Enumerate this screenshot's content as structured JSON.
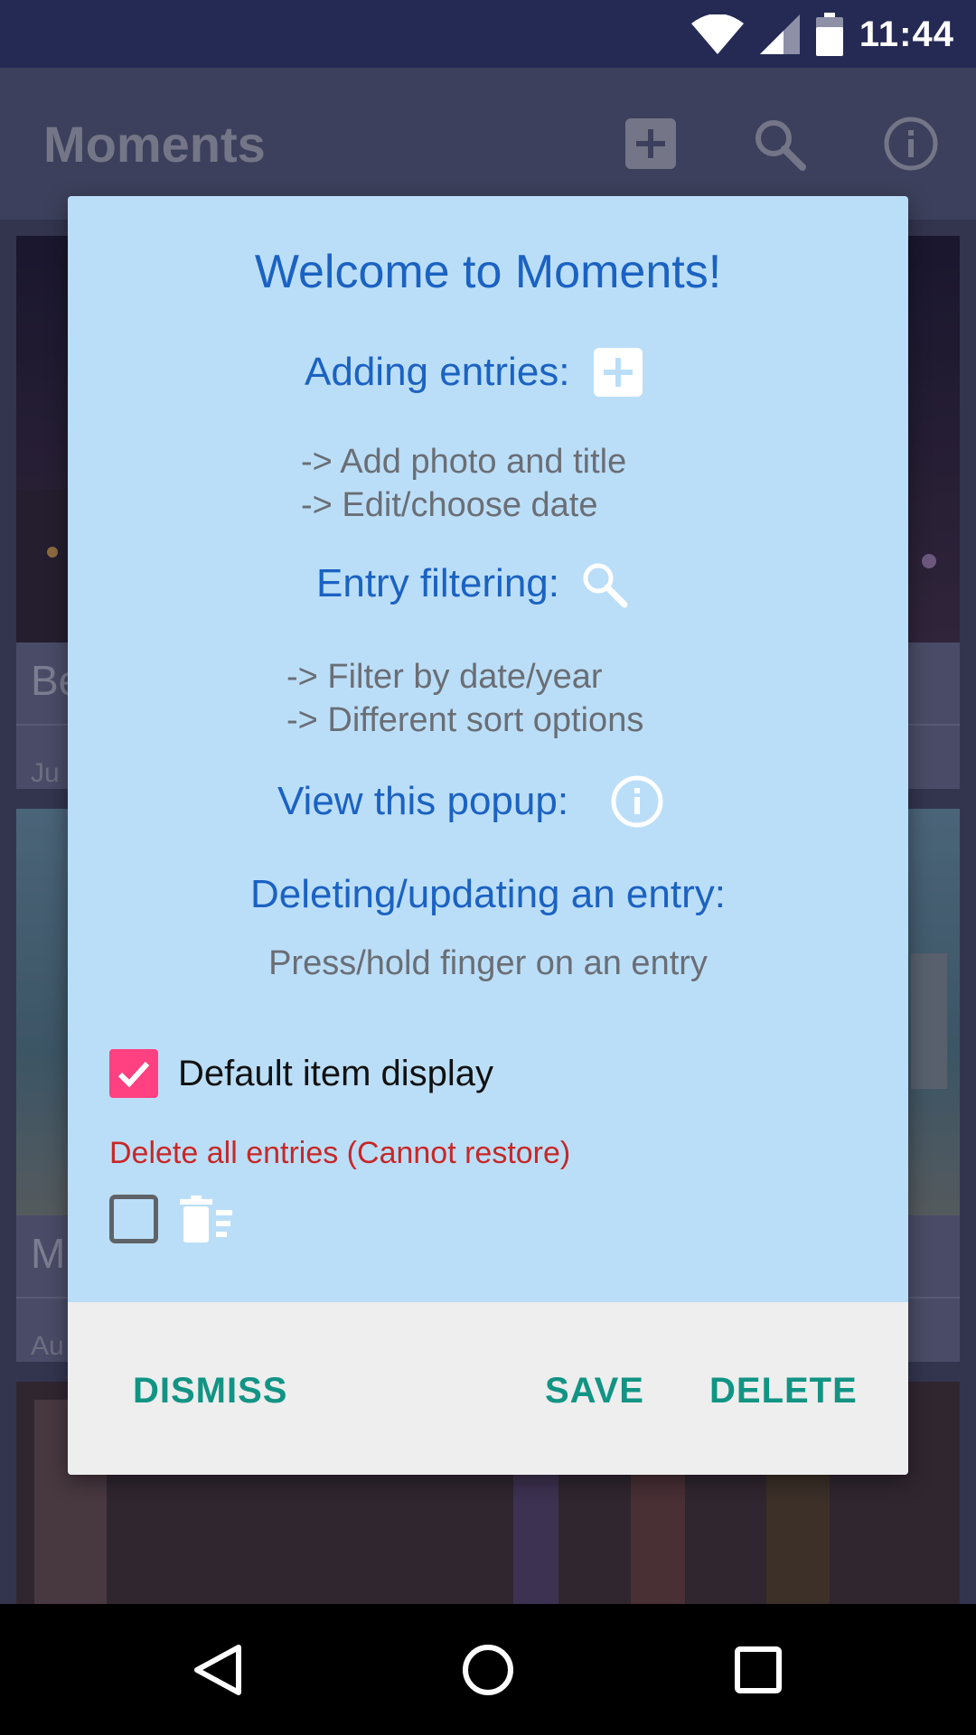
{
  "status_bar": {
    "time": "11:44",
    "icons": [
      "wifi-icon",
      "signal-icon",
      "battery-icon"
    ]
  },
  "app_bar": {
    "title": "Moments",
    "actions": [
      "add-box-icon",
      "search-icon",
      "info-icon"
    ]
  },
  "background_cards": [
    {
      "title": "Be",
      "date": "Ju"
    },
    {
      "title": "M",
      "date": "Au"
    },
    {
      "title": "",
      "date": ""
    }
  ],
  "dialog": {
    "title": "Welcome to Moments!",
    "adding": {
      "heading": "Adding entries:",
      "lines": [
        "-> Add photo and title",
        "-> Edit/choose date"
      ]
    },
    "filtering": {
      "heading": "Entry filtering:",
      "lines": [
        "-> Filter by date/year",
        "-> Different sort options"
      ]
    },
    "popup": {
      "heading": "View this popup:"
    },
    "deleting": {
      "heading": "Deleting/updating an entry:",
      "line": "Press/hold finger on an entry"
    },
    "default_display": {
      "label": "Default item display",
      "checked": true
    },
    "delete_all": {
      "label": "Delete all entries (Cannot restore)",
      "checked": false
    },
    "buttons": {
      "dismiss": "DISMISS",
      "save": "SAVE",
      "delete": "DELETE"
    }
  },
  "colors": {
    "dialog_bg": "#bbdef8",
    "heading_blue": "#1b62c2",
    "button_teal": "#129484",
    "warning_red": "#c62828",
    "checkbox_pink": "#ff4081"
  },
  "nav_bar": {
    "icons": [
      "back-icon",
      "home-icon",
      "recents-icon"
    ]
  }
}
